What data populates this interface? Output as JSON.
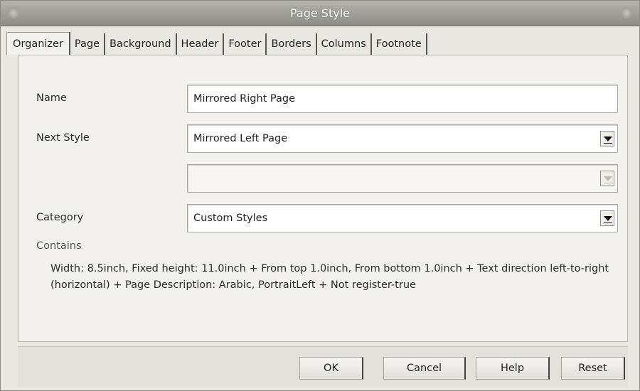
{
  "window": {
    "title": "Page Style"
  },
  "tabs": [
    {
      "label": "Organizer",
      "active": true
    },
    {
      "label": "Page"
    },
    {
      "label": "Background"
    },
    {
      "label": "Header"
    },
    {
      "label": "Footer"
    },
    {
      "label": "Borders"
    },
    {
      "label": "Columns"
    },
    {
      "label": "Footnote"
    }
  ],
  "form": {
    "name": {
      "label": "Name",
      "value": "Mirrored Right Page"
    },
    "next_style": {
      "label": "Next Style",
      "value": "Mirrored Left Page"
    },
    "linked_with": {
      "label": "",
      "value": ""
    },
    "category": {
      "label": "Category",
      "value": "Custom Styles"
    }
  },
  "contains": {
    "label": "Contains",
    "text": "Width: 8.5inch, Fixed height: 11.0inch + From top 1.0inch, From bottom 1.0inch + Text direction left-to-right (horizontal) + Page Description: Arabic, PortraitLeft + Not register-true"
  },
  "buttons": {
    "ok": "OK",
    "cancel": "Cancel",
    "help": "Help",
    "reset": "Reset"
  }
}
